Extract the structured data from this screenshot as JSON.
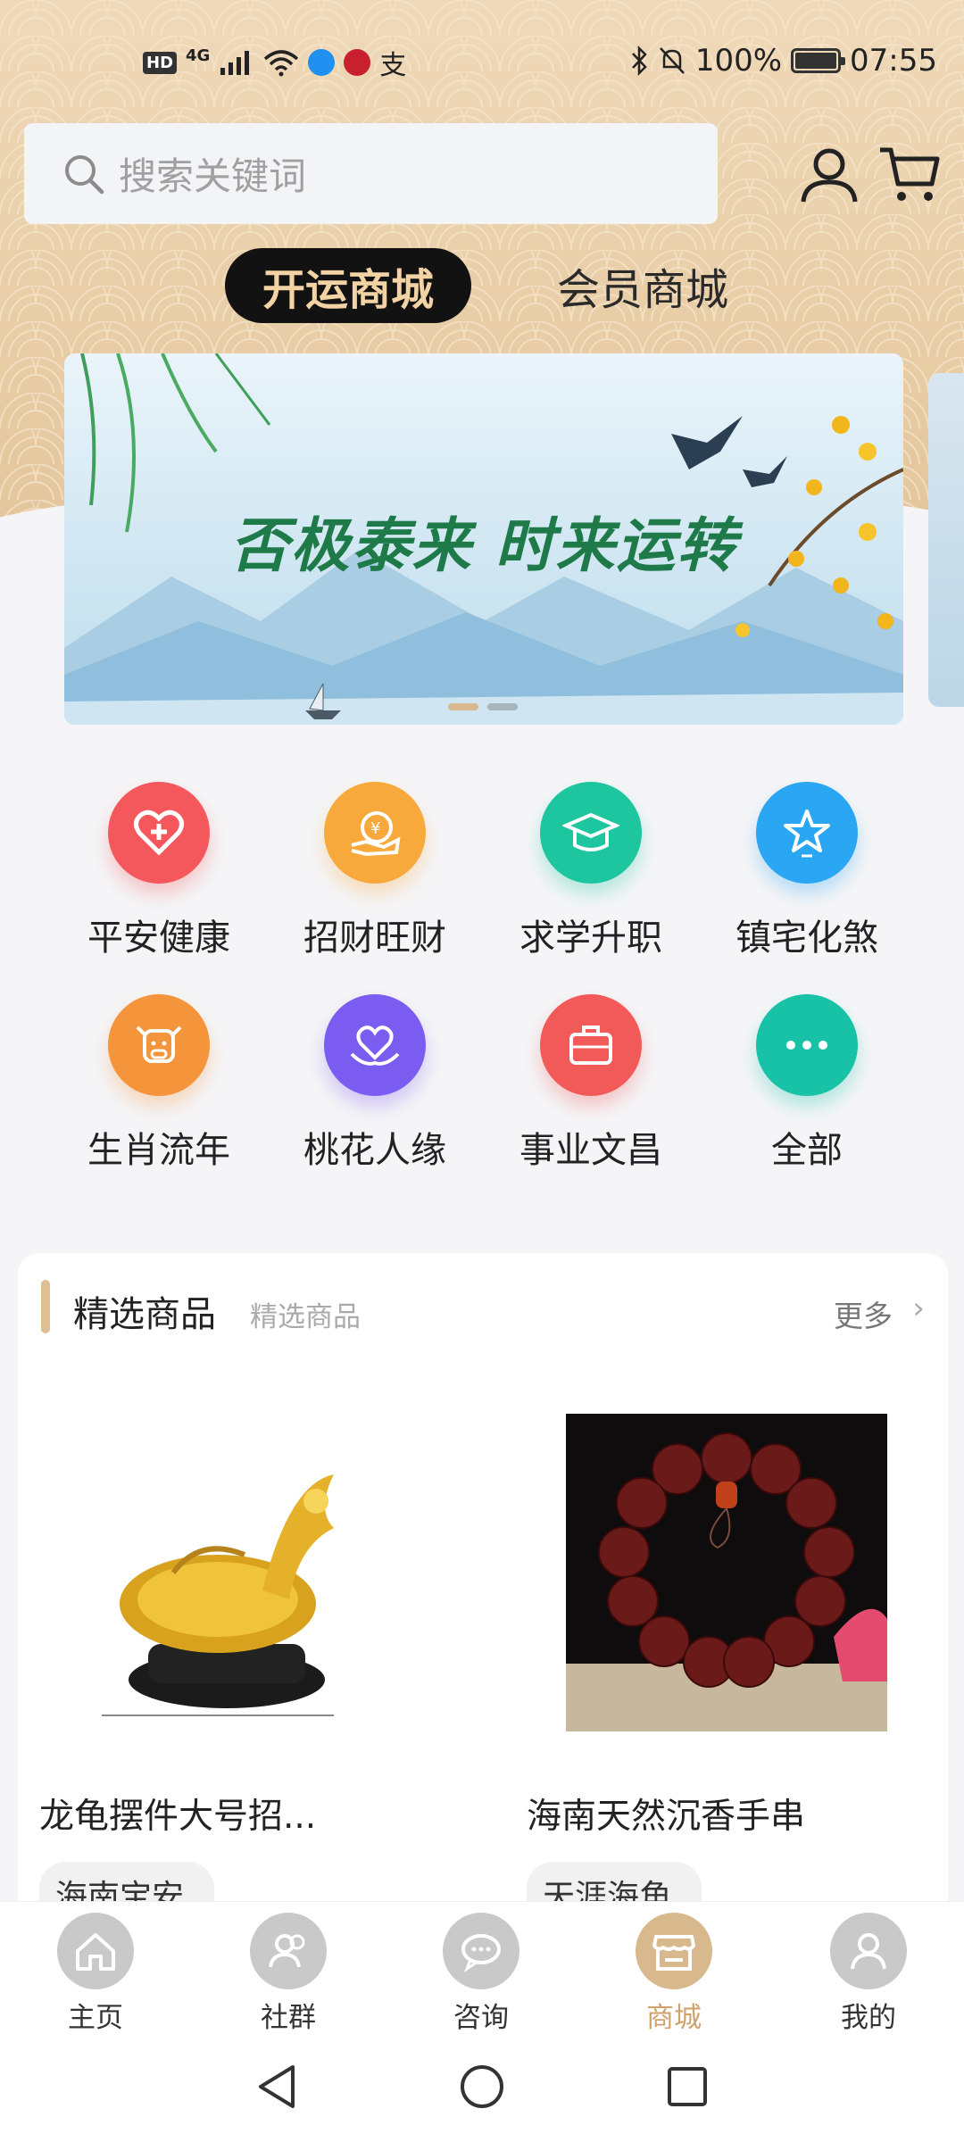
{
  "status_bar": {
    "network_badge": "HD",
    "network_type": "4G",
    "battery": "100%",
    "time": "07:55",
    "pay_icon": "支"
  },
  "search": {
    "placeholder": "搜索关键词"
  },
  "shop_tabs": [
    {
      "label": "开运商城",
      "active": true
    },
    {
      "label": "会员商城",
      "active": false
    }
  ],
  "banner": {
    "title": "否极泰来 时来运转",
    "page_index": 1,
    "page_count": 2,
    "indicator_active_color": "#d8b98d",
    "indicator_inactive_color": "#a9b4bd"
  },
  "categories": [
    {
      "label": "平安健康",
      "icon": "heart-plus-icon",
      "color": "#f5585c"
    },
    {
      "label": "招财旺财",
      "icon": "coin-hand-icon",
      "color": "#f7a93b"
    },
    {
      "label": "求学升职",
      "icon": "graduation-cap-icon",
      "color": "#1ec6a0"
    },
    {
      "label": "镇宅化煞",
      "icon": "star-icon",
      "color": "#2aa6f2"
    },
    {
      "label": "生肖流年",
      "icon": "ox-icon",
      "color": "#f5953b"
    },
    {
      "label": "桃花人缘",
      "icon": "heart-hands-icon",
      "color": "#7a5cf0"
    },
    {
      "label": "事业文昌",
      "icon": "briefcase-icon",
      "color": "#f25a5a"
    },
    {
      "label": "全部",
      "icon": "more-dots-icon",
      "color": "#17c2a6"
    }
  ],
  "featured": {
    "title": "精选商品",
    "subtitle": "精选商品",
    "more": "更多",
    "products": [
      {
        "name": "龙龟摆件大号招...",
        "tag": "海南宝安",
        "image": "golden-dragon-turtle-statue"
      },
      {
        "name": "海南天然沉香手串",
        "tag": "天涯海角",
        "image": "agarwood-bead-bracelet"
      }
    ]
  },
  "bottom_nav": [
    {
      "label": "主页",
      "icon": "home-icon",
      "active": false
    },
    {
      "label": "社群",
      "icon": "community-icon",
      "active": false
    },
    {
      "label": "咨询",
      "icon": "chat-icon",
      "active": false
    },
    {
      "label": "商城",
      "icon": "shop-icon",
      "active": true
    },
    {
      "label": "我的",
      "icon": "profile-icon",
      "active": false
    }
  ]
}
